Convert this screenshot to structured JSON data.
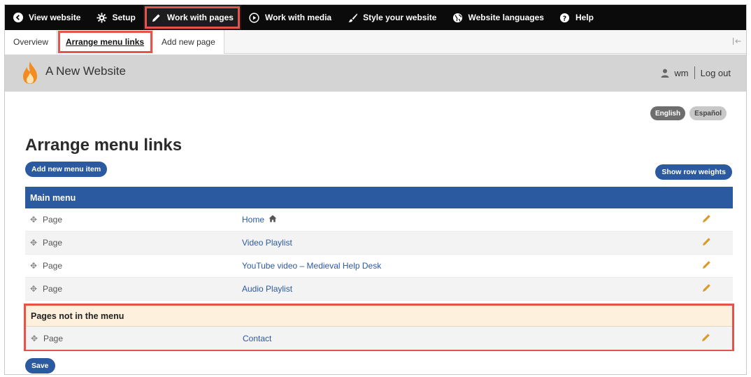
{
  "toolbar": {
    "items": [
      {
        "label": "View website",
        "icon": "chevron-left-circle-icon"
      },
      {
        "label": "Setup",
        "icon": "gear-icon"
      },
      {
        "label": "Work with pages",
        "icon": "pencil-icon"
      },
      {
        "label": "Work with media",
        "icon": "play-circle-icon"
      },
      {
        "label": "Style your website",
        "icon": "brush-icon"
      },
      {
        "label": "Website languages",
        "icon": "globe-icon"
      },
      {
        "label": "Help",
        "icon": "question-circle-icon"
      }
    ]
  },
  "tabs": [
    {
      "label": "Overview"
    },
    {
      "label": "Arrange menu links"
    },
    {
      "label": "Add new page"
    }
  ],
  "header": {
    "site_name": "A New Website",
    "username": "wm",
    "logout": "Log out"
  },
  "languages": [
    "English",
    "Español"
  ],
  "page": {
    "title": "Arrange menu links",
    "add_button": "Add new menu item",
    "weights_button": "Show row weights",
    "save_button": "Save"
  },
  "main_menu": {
    "heading": "Main menu",
    "rows": [
      {
        "type": "Page",
        "title": "Home"
      },
      {
        "type": "Page",
        "title": "Video Playlist"
      },
      {
        "type": "Page",
        "title": "YouTube video – Medieval Help Desk"
      },
      {
        "type": "Page",
        "title": "Audio Playlist"
      }
    ]
  },
  "not_in_menu": {
    "heading": "Pages not in the menu",
    "rows": [
      {
        "type": "Page",
        "title": "Contact"
      }
    ]
  },
  "colors": {
    "toolbar_bg": "#0b0b0b",
    "accent_blue": "#2c5aa0",
    "highlight_red": "#e4544a",
    "edit_icon": "#d99a2b"
  }
}
